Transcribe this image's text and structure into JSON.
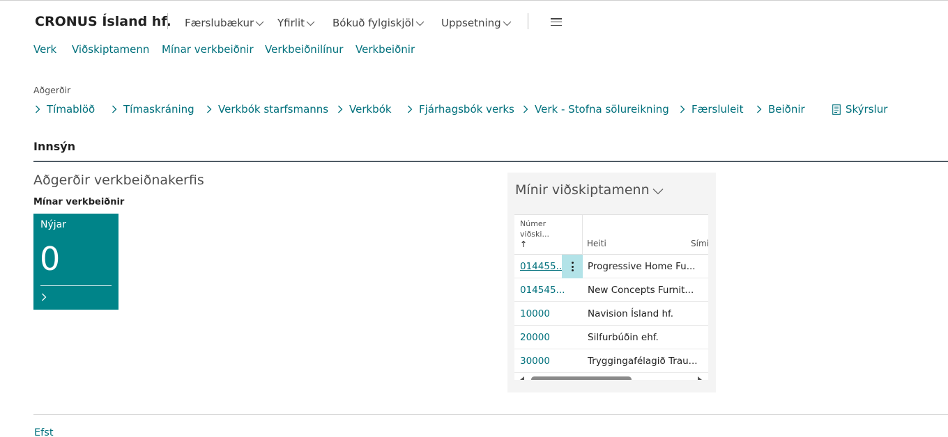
{
  "header": {
    "company": "CRONUS Ísland hf.",
    "top_nav": [
      {
        "label": "Færslubækur"
      },
      {
        "label": "Yfirlit"
      },
      {
        "label": "Bókuð fylgiskjöl"
      },
      {
        "label": "Uppsetning"
      }
    ]
  },
  "sub_nav": [
    {
      "label": "Verk"
    },
    {
      "label": "Viðskiptamenn"
    },
    {
      "label": "Mínar verkbeiðnir"
    },
    {
      "label": "Verkbeiðnilínur"
    },
    {
      "label": "Verkbeiðnir"
    }
  ],
  "actions": {
    "group_label": "Aðgerðir",
    "items": [
      {
        "label": "Tímablöð"
      },
      {
        "label": "Tímaskráning"
      },
      {
        "label": "Verkbók starfsmanns"
      },
      {
        "label": "Verkbók"
      },
      {
        "label": "Fjárhagsbók verks"
      },
      {
        "label": "Verk - Stofna sölureikning"
      },
      {
        "label": "Færsluleit"
      },
      {
        "label": "Beiðnir"
      }
    ],
    "reports_label": "Skýrslur"
  },
  "innsyn": {
    "label": "Innsýn"
  },
  "activities": {
    "title": "Aðgerðir verkbeiðnakerfis",
    "group": "Mínar verkbeiðnir",
    "tile": {
      "label": "Nýjar",
      "value": "0"
    }
  },
  "customers": {
    "title": "Mínir viðskiptamenn",
    "columns": {
      "number": [
        "Númer",
        "viðski..."
      ],
      "sort_arrow": "↑",
      "name": "Heiti",
      "phone": "Sími"
    },
    "rows": [
      {
        "number": "014455...",
        "name": "Progressive Home Fu..."
      },
      {
        "number": "014545...",
        "name": "New Concepts Furnit..."
      },
      {
        "number": "10000",
        "name": "Navision Ísland hf."
      },
      {
        "number": "20000",
        "name": "Silfurbúðin ehf."
      },
      {
        "number": "30000",
        "name": "Tryggingafélagið Trau..."
      }
    ]
  },
  "footer": {
    "top_link": "Efst"
  },
  "colors": {
    "accent": "#00707c",
    "tile": "#008489",
    "selected_cell": "#b3e3e8"
  }
}
